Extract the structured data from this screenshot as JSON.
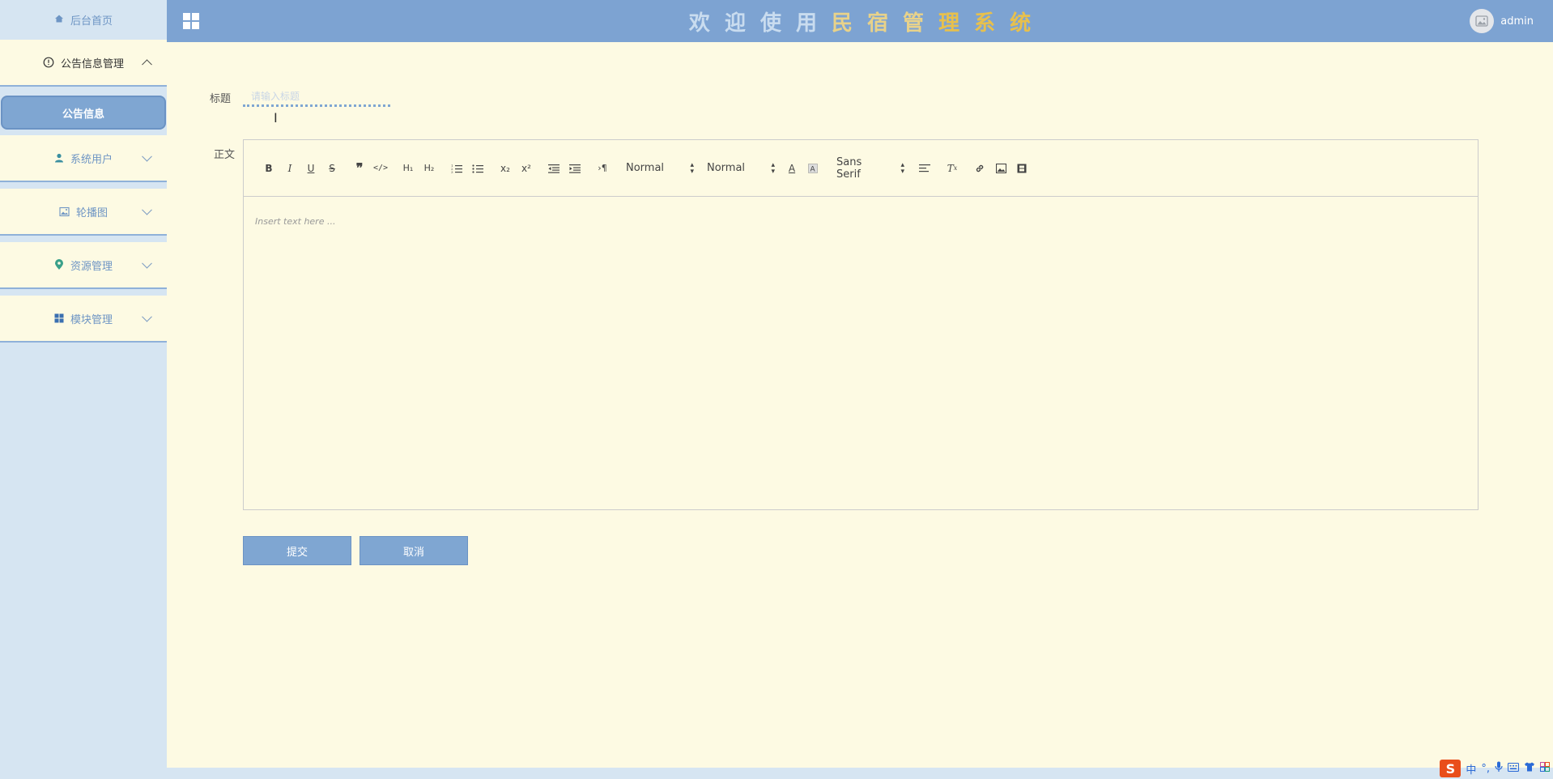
{
  "sidebar": {
    "home": "后台首页",
    "groups": [
      {
        "label": "公告信息管理",
        "icon": "info-circle-icon",
        "open": true,
        "children": [
          "公告信息"
        ]
      },
      {
        "label": "系统用户",
        "icon": "user-icon",
        "open": false
      },
      {
        "label": "轮播图",
        "icon": "image-icon",
        "open": false
      },
      {
        "label": "资源管理",
        "icon": "location-icon",
        "open": false
      },
      {
        "label": "模块管理",
        "icon": "grid-icon",
        "open": false
      }
    ]
  },
  "header": {
    "title_chars": [
      "欢",
      "迎",
      "使",
      "用",
      "民",
      "宿",
      "管",
      "理",
      "系",
      "统"
    ],
    "username": "admin"
  },
  "form": {
    "title_label": "标题",
    "title_placeholder": "请输入标题",
    "body_label": "正文",
    "editor": {
      "toolbar": {
        "header_select": "Normal",
        "size_select": "Normal",
        "font_select": "Sans Serif"
      },
      "placeholder": "Insert text here ..."
    },
    "submit_label": "提交",
    "cancel_label": "取消"
  },
  "tray": {
    "logo": "S",
    "lang": "中"
  },
  "colors": {
    "accent": "#7da3d2",
    "background": "#fdfae3",
    "sidebar": "#d6e5f2"
  }
}
